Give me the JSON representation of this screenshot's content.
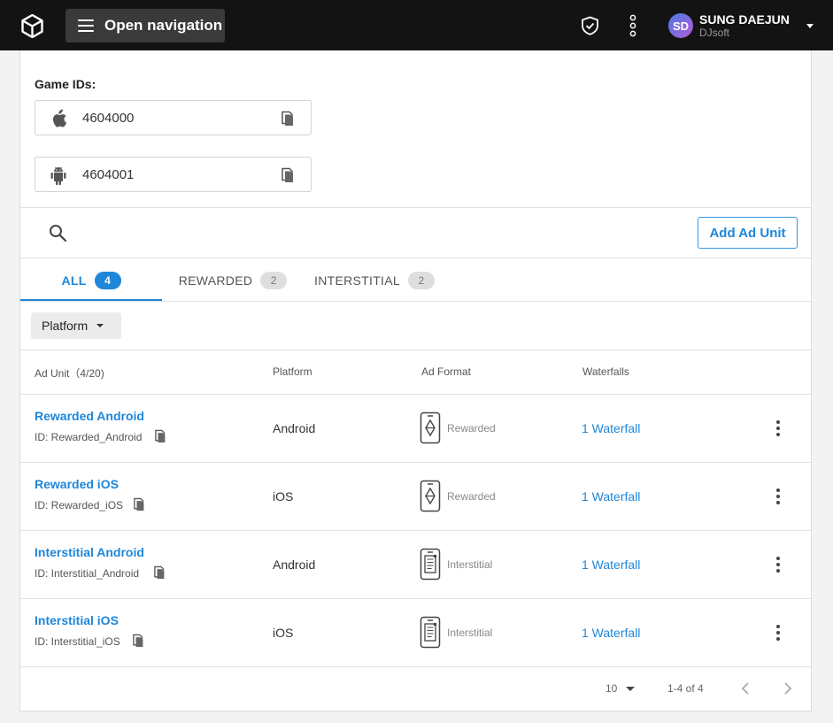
{
  "topbar": {
    "logo_icon": "unity-cube-icon",
    "nav_label": "Open navigation",
    "user": {
      "initials": "SD",
      "name": "SUNG DAEJUN",
      "org": "DJsoft"
    }
  },
  "game_ids": {
    "label": "Game IDs:",
    "ios": {
      "icon": "apple-icon",
      "value": "4604000"
    },
    "android": {
      "icon": "android-icon",
      "value": "4604001"
    }
  },
  "toolbar": {
    "add_label": "Add Ad Unit"
  },
  "tabs": [
    {
      "label": "ALL",
      "count": "4",
      "active": true
    },
    {
      "label": "REWARDED",
      "count": "2",
      "active": false
    },
    {
      "label": "INTERSTITIAL",
      "count": "2",
      "active": false
    }
  ],
  "filter": {
    "label": "Platform"
  },
  "table": {
    "headers": [
      "Ad Unit（4/20)",
      "Platform",
      "Ad Format",
      "Waterfalls"
    ],
    "rows": [
      {
        "name": "Rewarded Android",
        "id": "ID: Rewarded_Android",
        "platform": "Android",
        "format": "Rewarded",
        "waterfall": "1 Waterfall"
      },
      {
        "name": "Rewarded iOS",
        "id": "ID: Rewarded_iOS",
        "platform": "iOS",
        "format": "Rewarded",
        "waterfall": "1 Waterfall"
      },
      {
        "name": "Interstitial Android",
        "id": "ID: Interstitial_Android",
        "platform": "Android",
        "format": "Interstitial",
        "waterfall": "1 Waterfall"
      },
      {
        "name": "Interstitial iOS",
        "id": "ID: Interstitial_iOS",
        "platform": "iOS",
        "format": "Interstitial",
        "waterfall": "1 Waterfall"
      }
    ]
  },
  "pager": {
    "page_size": "10",
    "range": "1-4 of 4"
  },
  "colors": {
    "accent": "#1f86d8",
    "topbar": "#131313"
  }
}
